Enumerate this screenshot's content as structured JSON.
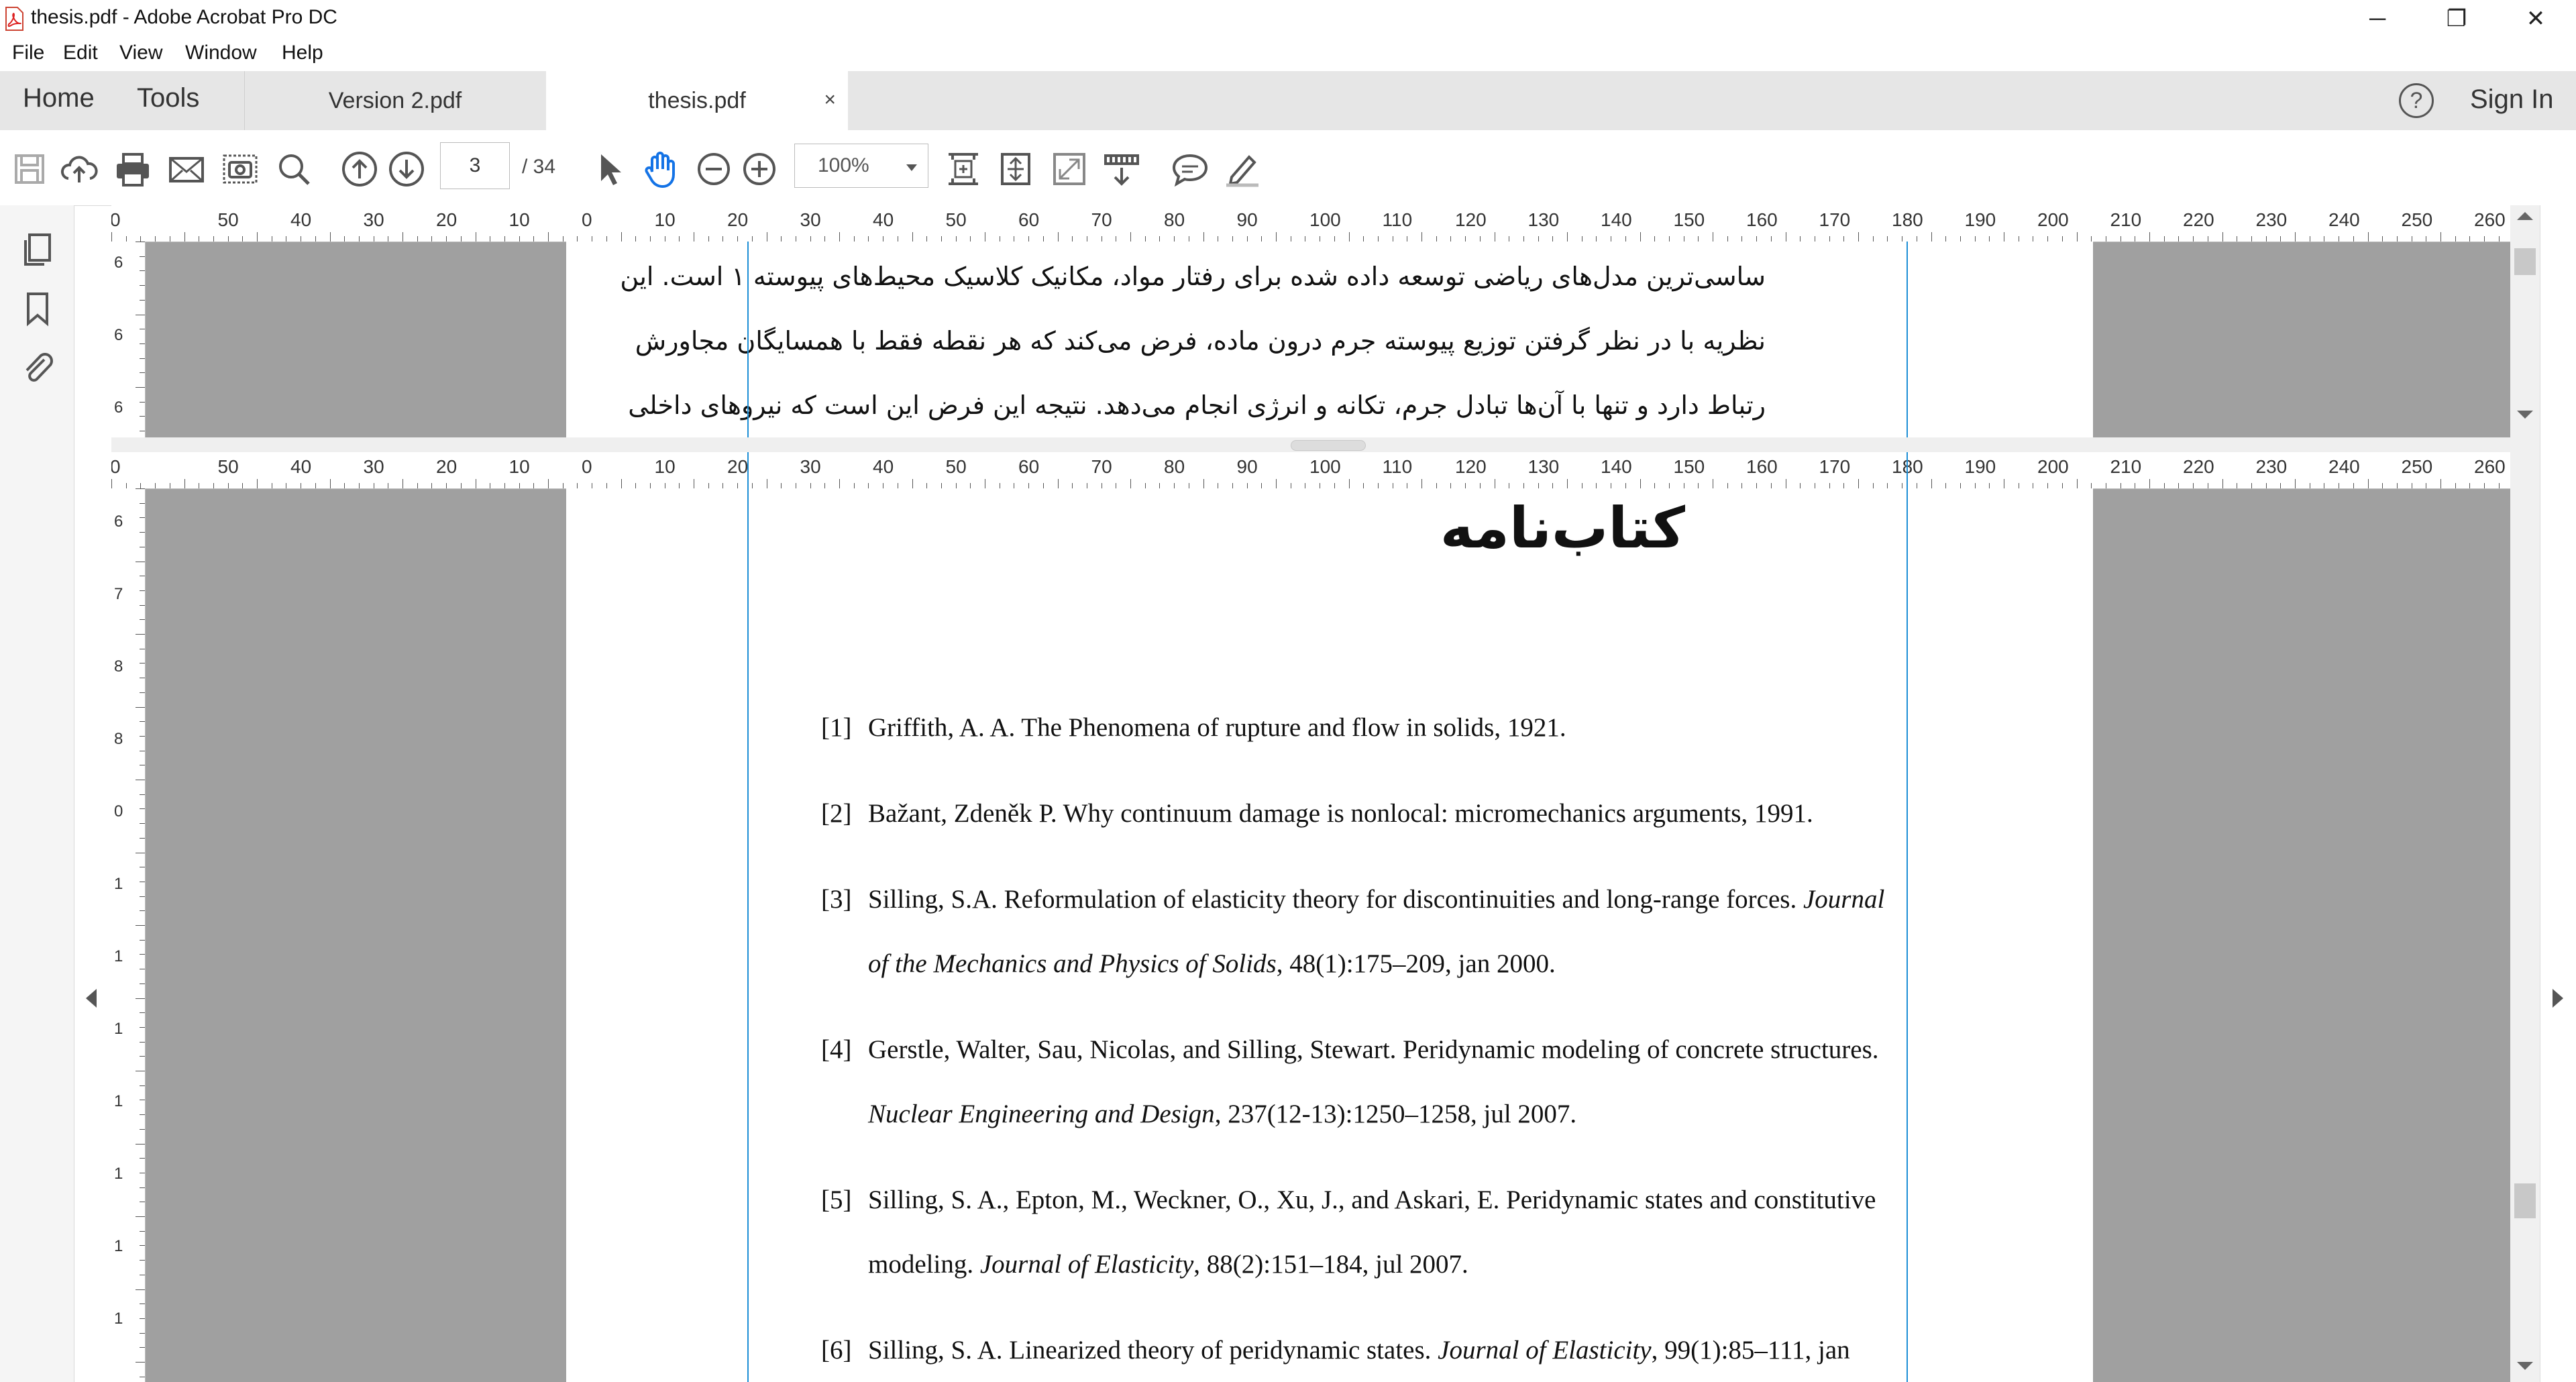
{
  "window": {
    "title": "thesis.pdf - Adobe Acrobat Pro DC",
    "controls": {
      "minimize": "─",
      "restore": "❐",
      "close": "✕"
    }
  },
  "menu": [
    "File",
    "Edit",
    "View",
    "Window",
    "Help"
  ],
  "nav": {
    "home": "Home",
    "tools": "Tools"
  },
  "tabs": [
    {
      "label": "Version 2.pdf",
      "active": false
    },
    {
      "label": "thesis.pdf",
      "active": true,
      "close": "×"
    }
  ],
  "account": {
    "help": "?",
    "signin": "Sign In"
  },
  "toolbar": {
    "page_current": "3",
    "page_total": "/ 34",
    "zoom": "100%"
  },
  "rulers": {
    "h_labels": [
      "0",
      "50",
      "40",
      "30",
      "20",
      "10",
      "0",
      "10",
      "20",
      "30",
      "40",
      "50",
      "60",
      "70",
      "80",
      "90",
      "100",
      "110",
      "120",
      "130",
      "140",
      "150",
      "160",
      "170",
      "180",
      "190",
      "200",
      "210",
      "220",
      "230",
      "240",
      "250",
      "260"
    ],
    "v_top": [
      "6",
      "6",
      "6"
    ],
    "v_bottom": [
      "6",
      "7",
      "8",
      "8",
      "0",
      "1",
      "1",
      "1",
      "1",
      "1",
      "1",
      "1"
    ]
  },
  "document": {
    "top_pane_lines": [
      "ساسی‌ترین مدل‌های ریاضی توسعه داده شده برای رفتار مواد، مکانیک کلاسیک محیط‌های پیوسته ۱ است. این",
      "نظریه با در نظر گرفتن توزیع پیوسته جرم درون ماده، فرض می‌کند که هر نقطه فقط با همسایگان مجاورش",
      "رتباط دارد و تنها با آن‌ها تبادل جرم، تکانه و انرژی انجام می‌دهد. نتیجه این فرض این است که نیروهای داخلی"
    ],
    "bib_title": "کتاب‌نامه",
    "references": [
      {
        "num": "[1]",
        "line1": "Griffith, A. A. The Phenomena of rupture and flow in solids, 1921.",
        "line2": ""
      },
      {
        "num": "[2]",
        "line1": "Bažant, Zdeněk P. Why continuum damage is nonlocal: micromechanics arguments, 1991.",
        "line2": ""
      },
      {
        "num": "[3]",
        "line1": "Silling, S.A. Reformulation of elasticity theory for discontinuities and long-range forces.",
        "line1_italic": " Journal",
        "line2_italic": "of the Mechanics and Physics of Solids",
        "line2": ", 48(1):175–209, jan 2000."
      },
      {
        "num": "[4]",
        "line1": "Gerstle, Walter, Sau, Nicolas, and Silling, Stewart. Peridynamic modeling of concrete structures.",
        "line2_italic": "Nuclear Engineering and Design",
        "line2": ", 237(12-13):1250–1258, jul 2007."
      },
      {
        "num": "[5]",
        "line1": "Silling, S. A., Epton, M., Weckner, O., Xu, J., and Askari, E. Peridynamic states and constitutive",
        "line2_pre": "modeling. ",
        "line2_italic": "Journal of Elasticity",
        "line2": ", 88(2):151–184, jul 2007."
      },
      {
        "num": "[6]",
        "line1": "Silling, S. A. Linearized theory of peridynamic states.",
        "line1_italic": " Journal of Elasticity",
        "line1_post": ", 99(1):85–111, jan",
        "line2": ""
      }
    ]
  }
}
